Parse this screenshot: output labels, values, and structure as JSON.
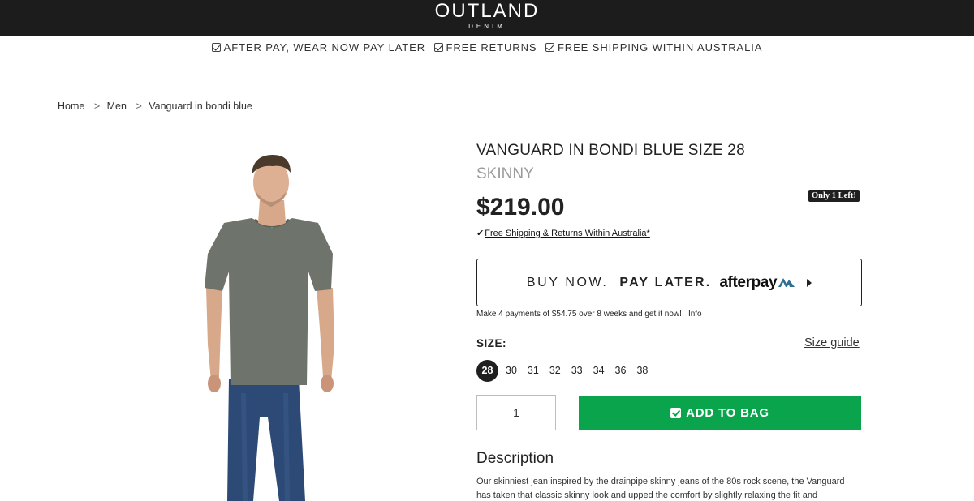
{
  "header": {
    "logo_main": "OUTLAND",
    "logo_sub": "DENIM"
  },
  "benefits": [
    {
      "label": "AFTER PAY, WEAR NOW PAY LATER",
      "icon": "check-square-icon"
    },
    {
      "label": "FREE RETURNS",
      "icon": "check-square-icon"
    },
    {
      "label": "FREE SHIPPING WITHIN AUSTRALIA",
      "icon": "check-square-icon"
    }
  ],
  "breadcrumb": {
    "home": "Home",
    "category": "Men",
    "current": "Vanguard in bondi blue",
    "separator": ">"
  },
  "product": {
    "title": "VANGUARD IN BONDI BLUE SIZE 28",
    "subtitle": "SKINNY",
    "price": "$219.00",
    "stock_badge": "Only 1 Left!",
    "shipping_tick": "✔",
    "shipping_note": "Free Shipping & Returns Within Australia*"
  },
  "afterpay": {
    "buy_now": "BUY NOW.",
    "pay_later": "PAY LATER.",
    "logo": "afterpay",
    "installments": "Make 4 payments of $54.75 over 8 weeks and get it now!",
    "info": "Info"
  },
  "sizes": {
    "label": "SIZE:",
    "guide": "Size guide",
    "options": [
      "28",
      "30",
      "31",
      "32",
      "33",
      "34",
      "36",
      "38"
    ],
    "selected": "28"
  },
  "cart": {
    "quantity": "1",
    "add_to_bag": "ADD TO BAG"
  },
  "description": {
    "heading": "Description",
    "text": "Our skinniest jean inspired by the drainpipe skinny jeans of the 80s rock scene, the Vanguard has taken that classic skinny look and upped the comfort by slightly relaxing the fit and incorporating"
  },
  "colors": {
    "topbar": "#1c1c1c",
    "add_to_bag": "#09a44b",
    "afterpay_mint": "#2f6f8f"
  }
}
